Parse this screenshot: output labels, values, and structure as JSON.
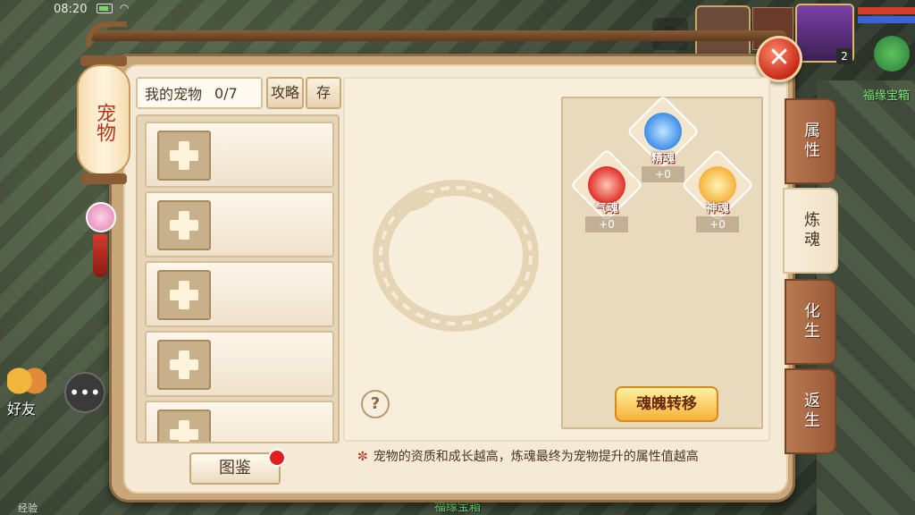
{
  "status": {
    "time": "08:20"
  },
  "hud": {
    "level": "2",
    "gift_label": "福缘宝箱",
    "friend_label": "好友",
    "exp_label": "经验",
    "bottom_label": "福缘宝箱"
  },
  "lantern": {
    "title": "宠物"
  },
  "pets": {
    "title": "我的宠物",
    "count": "0/7",
    "strategy_button": "攻略",
    "store_button": "存",
    "slots": [
      "",
      "",
      "",
      "",
      ""
    ]
  },
  "codex": {
    "label": "图鉴"
  },
  "souls": {
    "jing": {
      "name": "精魂",
      "value": "+0",
      "color": "#3f8ee8"
    },
    "qi": {
      "name": "气魂",
      "value": "+0",
      "color": "#e0302a"
    },
    "shen": {
      "name": "神魂",
      "value": "+0",
      "color": "#f5b23a"
    }
  },
  "transfer_button": "魂魄转移",
  "help": "?",
  "tip": "宠物的资质和成长越高，炼魂最终为宠物提升的属性值越高",
  "tabs": [
    {
      "label": "属性",
      "active": false
    },
    {
      "label": "炼魂",
      "active": true
    },
    {
      "label": "化生",
      "active": false
    },
    {
      "label": "返生",
      "active": false
    }
  ]
}
